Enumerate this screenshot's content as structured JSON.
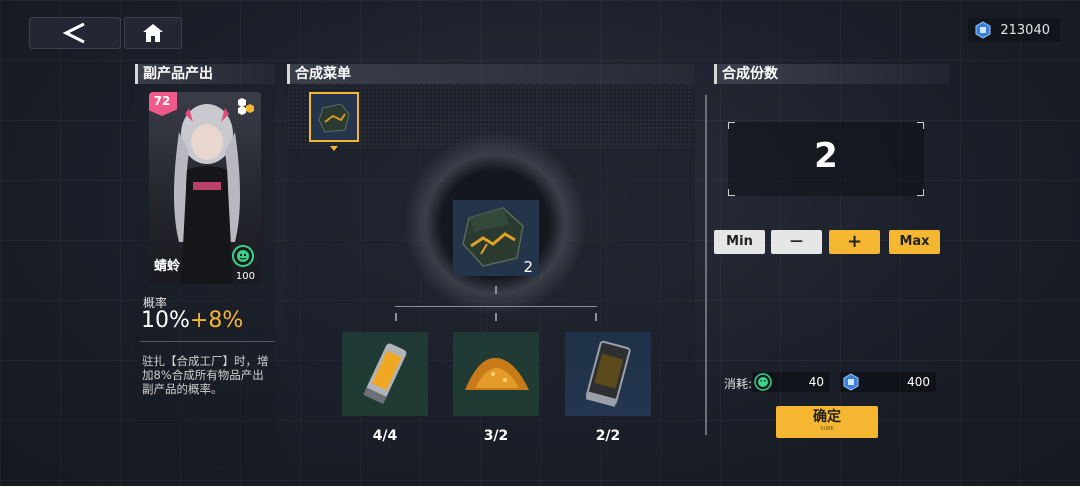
{
  "header": {
    "back_icon": "back-arrow-icon",
    "home_icon": "home-icon",
    "currency_icon": "chip-icon",
    "currency_value": "213040"
  },
  "left": {
    "title": "副产品产出",
    "character": {
      "level": "72",
      "name": "蜻蛉",
      "count": "100"
    },
    "prob_label": "概率",
    "prob_base": "10%",
    "prob_bonus": "+8%",
    "description": "驻扎【合成工厂】时，增加8%合成所有物品产出副产品的概率。"
  },
  "center": {
    "title": "合成菜单",
    "output_count": "2",
    "ingredients": [
      {
        "label": "4/4",
        "icon": "battery-cell-icon"
      },
      {
        "label": "3/2",
        "icon": "ore-pile-icon"
      },
      {
        "label": "2/2",
        "icon": "canister-icon"
      }
    ]
  },
  "right": {
    "title": "合成份数",
    "quantity": "2",
    "min_label": "Min",
    "minus_label": "—",
    "plus_label": "+",
    "max_label": "Max",
    "cost_label": "消耗:",
    "cost_items": [
      {
        "icon": "green-face-icon",
        "value": "40"
      },
      {
        "icon": "chip-icon",
        "value": "400"
      }
    ],
    "confirm_label": "确定",
    "confirm_sub": "SURE"
  },
  "colors": {
    "accent": "#f5b731",
    "bonus": "#f5b731",
    "level_badge": "#f05a8a"
  }
}
